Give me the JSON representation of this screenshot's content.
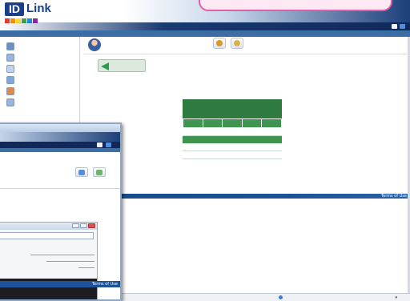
{
  "header": {
    "logo_id": "ID",
    "logo_link": "Link",
    "logo_squares": [
      "#e53935",
      "#fb8c00",
      "#fdd835",
      "#43a047",
      "#1e88e5",
      "#8e24aa"
    ],
    "brand_color": "#1a3e8a",
    "highlight_color": "#e35fa2"
  },
  "footer": {
    "terms_label": "Terms of Use",
    "terms_label_window": "Terms of Use"
  },
  "colors": {
    "order_green": "#2f7a3e",
    "footer_blue": "#1c5297",
    "breadcrumb_blue": "#3a6ea5"
  },
  "sidebar": {
    "items": [
      {
        "icon": "logout-icon",
        "color": "#6d8fc4"
      },
      {
        "icon": "calendar-icon",
        "color": "#9bb3d6"
      },
      {
        "icon": "document-icon",
        "color": "#c4d3e8"
      },
      {
        "icon": "image-icon",
        "color": "#7fa7d9"
      },
      {
        "icon": "file-icon",
        "color": "#e08a4a"
      },
      {
        "icon": "question-icon",
        "color": "#9bb3d6"
      }
    ]
  },
  "window": {
    "toolbar_icons": [
      "#5b8dd6",
      "#6fb36f",
      "#d9a441"
    ],
    "status_icons": [
      "#f1f1f1",
      "#4f8ed8",
      "#cfd8e6"
    ]
  }
}
